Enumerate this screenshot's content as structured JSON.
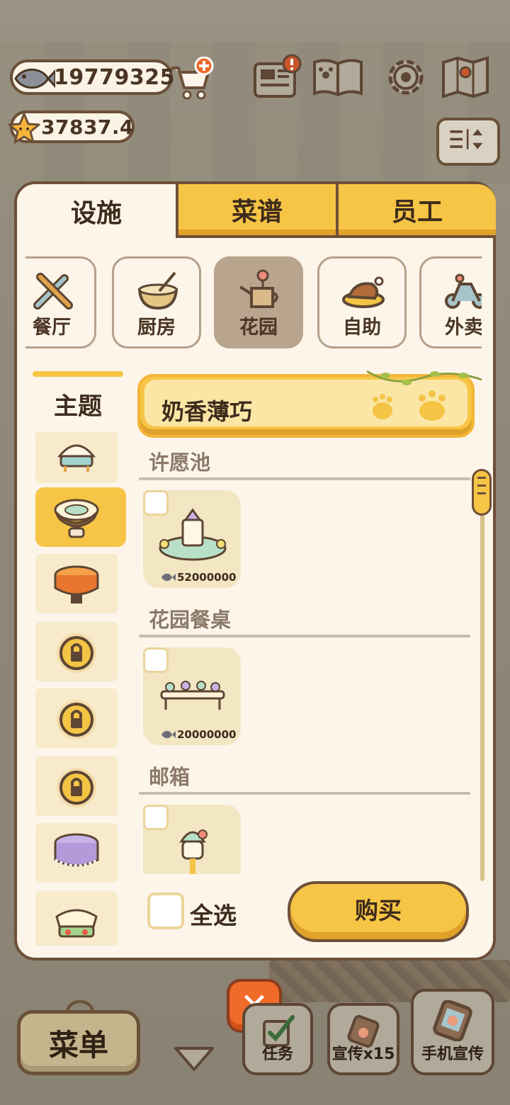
{
  "hud": {
    "fish_amount": "19779325",
    "star_amount": "37837.4"
  },
  "tabs": [
    {
      "label": "设施",
      "active": true
    },
    {
      "label": "菜谱",
      "active": false
    },
    {
      "label": "员工",
      "active": false
    }
  ],
  "categories": [
    {
      "label": "餐厅",
      "icon": "tools-icon"
    },
    {
      "label": "厨房",
      "icon": "mixing-bowl-icon"
    },
    {
      "label": "花园",
      "icon": "watering-can-icon",
      "active": true
    },
    {
      "label": "自助",
      "icon": "food-plate-icon"
    },
    {
      "label": "外卖",
      "icon": "scooter-icon"
    }
  ],
  "theme_sidebar": {
    "title": "主题",
    "locked_count": 3
  },
  "theme_header": {
    "name": "奶香薄巧"
  },
  "sections": [
    {
      "title": "许愿池",
      "price": "52000000",
      "icon": "fountain-icon"
    },
    {
      "title": "花园餐桌",
      "price": "20000000",
      "icon": "garden-table-icon"
    },
    {
      "title": "邮箱",
      "price": "",
      "icon": "mailbox-icon"
    }
  ],
  "footer": {
    "select_all_label": "全选",
    "buy_label": "购买"
  },
  "close_label": "✕",
  "bottom_bar": {
    "menu_label": "菜单",
    "task_label": "任务",
    "promo_label": "宣传x15",
    "phone_label": "手机宣传"
  },
  "colors": {
    "accent_yellow": "#f7c545",
    "panel_bg": "#fdf5ea",
    "border_brown": "#6e5038",
    "close_orange": "#f06a2a"
  }
}
